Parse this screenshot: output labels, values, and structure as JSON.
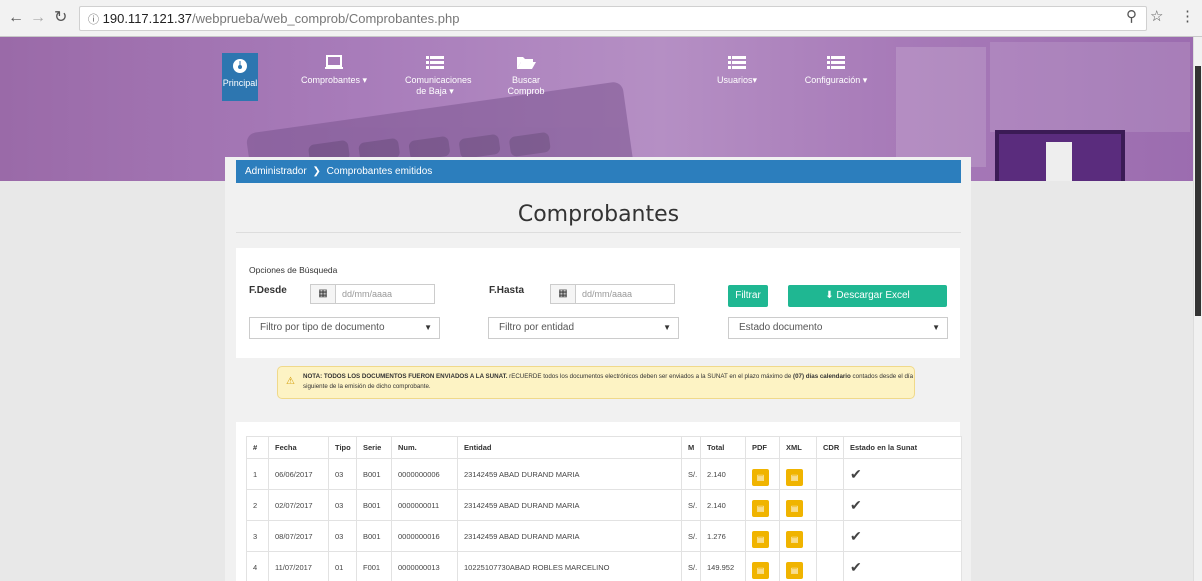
{
  "browser": {
    "url_host": "190.117.121.37",
    "url_path": "/webprueba/web_comprob/Comprobantes.php"
  },
  "nav": {
    "items": [
      {
        "label": "Principal",
        "icon": "dashboard-icon"
      },
      {
        "label": "Comprobantes ▾",
        "icon": "laptop-icon"
      },
      {
        "label": "Comunicaciones de Baja ▾",
        "icon": "list-icon"
      },
      {
        "label": "Buscar Comprob",
        "icon": "folder-open-icon"
      },
      {
        "label": "Usuarios▾",
        "icon": "list-icon"
      },
      {
        "label": "Configuración ▾",
        "icon": "list-icon"
      }
    ]
  },
  "breadcrumb": {
    "root": "Administrador",
    "sep": "❯",
    "current": "Comprobantes emitidos"
  },
  "page": {
    "title": "Comprobantes"
  },
  "filters": {
    "section_label": "Opciones de Búsqueda",
    "from_label": "F.Desde",
    "to_label": "F.Hasta",
    "date_placeholder": "dd/mm/aaaa",
    "filter_button": "Filtrar",
    "excel_button": "Descargar Excel",
    "doc_type_select": "Filtro por tipo de documento",
    "entity_select": "Filtro por entidad",
    "status_select": "Estado documento"
  },
  "note": {
    "bold": "NOTA: TODOS LOS DOCUMENTOS FUERON ENVIADOS A LA SUNAT.",
    "text1": "rECUERDE todos los documentos electrónicos deben ser enviados a la SUNAT en el plazo máximo de",
    "bold2": "(07) días calendario",
    "text2": "contados desde el día siguiente de la emisión de dicho comprobante."
  },
  "table": {
    "headers": [
      "#",
      "Fecha",
      "Tipo",
      "Serie",
      "Num.",
      "Entidad",
      "M",
      "Total",
      "PDF",
      "XML",
      "CDR",
      "Estado en la Sunat"
    ],
    "rows": [
      [
        "1",
        "06/06/2017",
        "03",
        "B001",
        "0000000006",
        "23142459 ABAD DURAND MARIA",
        "S/.",
        "2.140"
      ],
      [
        "2",
        "02/07/2017",
        "03",
        "B001",
        "0000000011",
        "23142459 ABAD DURAND MARIA",
        "S/.",
        "2.140"
      ],
      [
        "3",
        "08/07/2017",
        "03",
        "B001",
        "0000000016",
        "23142459 ABAD DURAND MARIA",
        "S/.",
        "1.276"
      ],
      [
        "4",
        "11/07/2017",
        "01",
        "F001",
        "0000000013",
        "10225107730ABAD ROBLES MARCELINO",
        "S/.",
        "149.952"
      ]
    ]
  },
  "colors": {
    "brand": "#2c7ebd",
    "accent": "#1fb792",
    "warning": "#f0b400",
    "hero": "#a87cba"
  }
}
